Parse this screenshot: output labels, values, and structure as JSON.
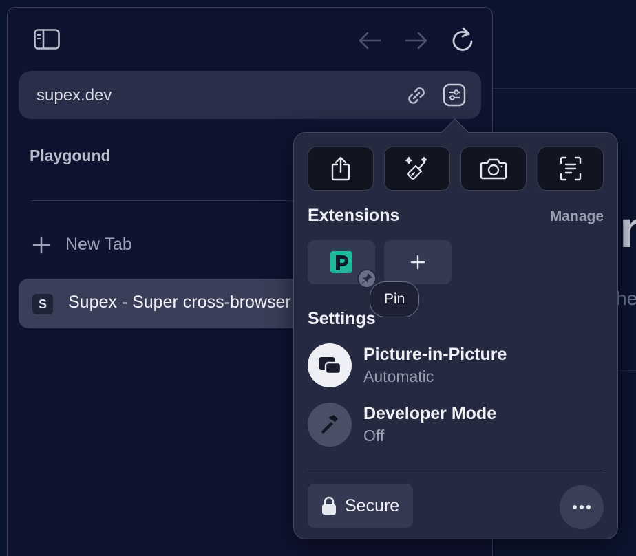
{
  "background": {
    "heading_fragment": "n",
    "text_fragment": "he"
  },
  "sidebar": {
    "address": "supex.dev",
    "section_label": "Playgound",
    "new_tab_label": "New Tab",
    "active_tab": {
      "favicon_letter": "S",
      "title": "Supex - Super cross-browser extension"
    }
  },
  "popover": {
    "quick_actions": [
      {
        "icon": "share-icon"
      },
      {
        "icon": "magic-brush-icon"
      },
      {
        "icon": "camera-icon"
      },
      {
        "icon": "text-scan-icon"
      }
    ],
    "extensions_title": "Extensions",
    "manage_label": "Manage",
    "add_extension_icon": "plus-icon",
    "tooltip": "Pin",
    "settings_title": "Settings",
    "settings": [
      {
        "title": "Picture-in-Picture",
        "subtitle": "Automatic",
        "icon": "picture-in-picture-icon"
      },
      {
        "title": "Developer Mode",
        "subtitle": "Off",
        "icon": "hammer-icon"
      }
    ],
    "secure_label": "Secure"
  },
  "colors": {
    "background": "#0c1530",
    "sidebar": "#0f1330",
    "popover": "#262a40",
    "extension_brand": "#1fb89a"
  }
}
